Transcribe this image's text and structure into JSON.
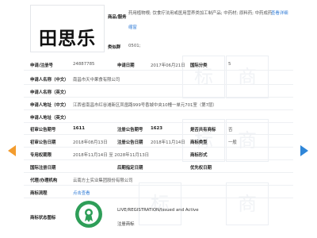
{
  "mark": {
    "text": "田思乐"
  },
  "header": {
    "goods_label": "商品/服务",
    "goods_value": "药用植物根; 饮食疗法用或医用营养类加工制产品; 中药材; 原料药; 中药成药",
    "more_link": "查看详细",
    "reduce_link": "缩窗",
    "class_group_label": "类似群",
    "class_group_value": "0501;"
  },
  "rows": {
    "reg_no_label": "申请/注册号",
    "reg_no_value": "24887785",
    "apply_date_label": "申请日期",
    "apply_date_value": "2017年06月21日",
    "intl_class_label": "国际分类",
    "intl_class_value": "5",
    "applicant_cn_label": "申请人名称（中文）",
    "applicant_cn_value": "南昌市天中果食有限公司",
    "applicant_en_label": "申请人名称（英文）",
    "address_cn_label": "申请人地址（中文）",
    "address_cn_value": "江西省南昌市红谷滩新区凤凰路999号香城中央10幢一单元701室（第7层）",
    "address_en_label": "申请人地址（英文）",
    "prelim_no_label": "初审公告期号",
    "prelim_no_value": "1611",
    "reg_ann_no_label": "注册公告期号",
    "reg_ann_no_value": "1623",
    "shared_label": "是否共有商标",
    "shared_value": "否",
    "prelim_date_label": "初审公告日期",
    "prelim_date_value": "2018年08月13日",
    "reg_ann_date_label": "注册公告日期",
    "reg_ann_date_value": "2018年11月14日",
    "mark_type_label": "商标类型",
    "mark_type_value": "一般",
    "exclusive_label": "专用权期限",
    "exclusive_value": "2018年11月14日 至 2028年11月13日",
    "mark_form_label": "商标形式",
    "intl_reg_date_label": "国际注册日期",
    "later_date_label": "后期指定日期",
    "priority_date_label": "优先权日期",
    "agent_label": "代理/办理机构",
    "agent_value": "云南方土实业集团股份有限公司",
    "process_label": "商标流程",
    "process_link": "点击查看",
    "status_icon_label": "商标状态图标",
    "status_en": "LIVE/REGISTRATION/Issued and Active",
    "status_cn": "注册商标"
  },
  "colors": {
    "accent": "#2f7bd6",
    "left_arrow": "#f39c2e",
    "right_arrow": "#2f86d8",
    "badge": "#2e9e58"
  },
  "icons": [
    "arrow-left-icon",
    "arrow-right-icon",
    "registered-badge-icon"
  ]
}
